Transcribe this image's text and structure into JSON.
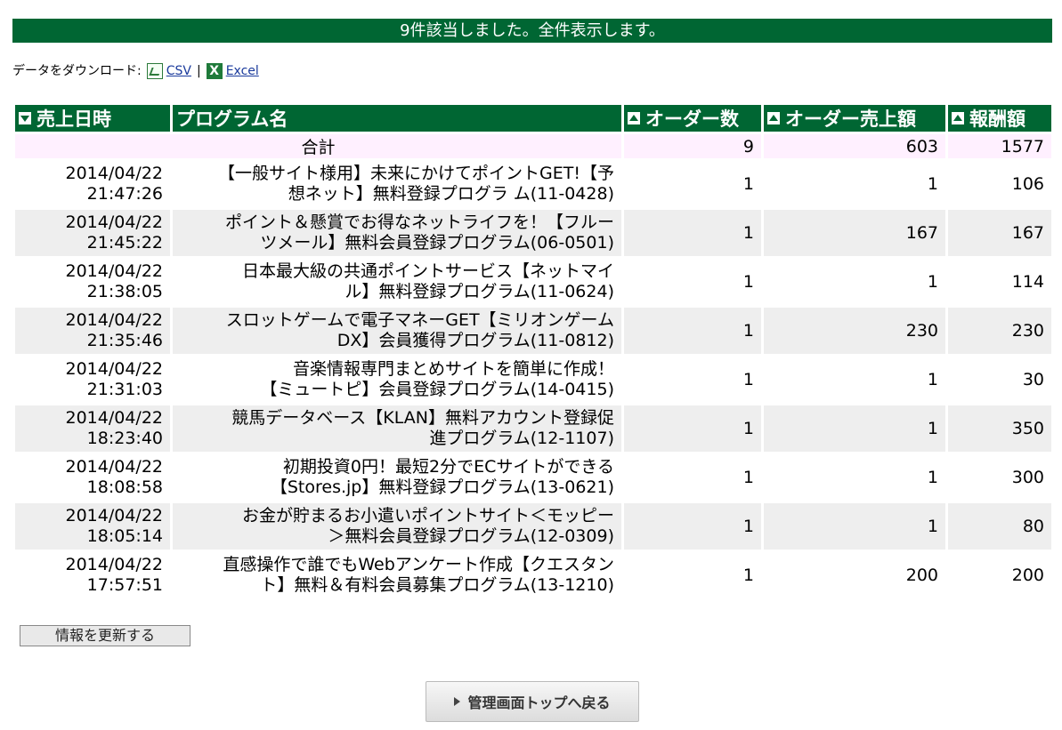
{
  "banner": {
    "text": "9件該当しました。全件表示します。"
  },
  "download": {
    "label": "データをダウンロード:",
    "csv_icon": "csv-file-icon",
    "csv_label": "CSV",
    "separator": "|",
    "excel_icon": "excel-file-icon",
    "excel_label": "Excel"
  },
  "table": {
    "headers": [
      {
        "label": "売上日時",
        "sort": "down"
      },
      {
        "label": "プログラム名",
        "sort": "none"
      },
      {
        "label": "オーダー数",
        "sort": "up"
      },
      {
        "label": "オーダー売上額",
        "sort": "up"
      },
      {
        "label": "報酬額",
        "sort": "up"
      }
    ],
    "total": {
      "label": "合計",
      "orders": "9",
      "sales": "603",
      "reward": "1577"
    },
    "rows": [
      {
        "date": "2014/04/22",
        "time": "21:47:26",
        "program_l1": "【一般サイト様用】未来にかけてポイントGET!【予",
        "program_l2": "想ネット】無料登録プログラ ム(11-0428)",
        "orders": "1",
        "sales": "1",
        "reward": "106"
      },
      {
        "date": "2014/04/22",
        "time": "21:45:22",
        "program_l1": "ポイント＆懸賞でお得なネットライフを！【フルー",
        "program_l2": "ツメール】無料会員登録プログラム(06-0501)",
        "orders": "1",
        "sales": "167",
        "reward": "167"
      },
      {
        "date": "2014/04/22",
        "time": "21:38:05",
        "program_l1": "日本最大級の共通ポイントサービス【ネットマイ",
        "program_l2": "ル】無料登録プログラム(11-0624)",
        "orders": "1",
        "sales": "1",
        "reward": "114"
      },
      {
        "date": "2014/04/22",
        "time": "21:35:46",
        "program_l1": "スロットゲームで電子マネーGET【ミリオンゲーム",
        "program_l2": "DX】会員獲得プログラム(11-0812)",
        "orders": "1",
        "sales": "230",
        "reward": "230"
      },
      {
        "date": "2014/04/22",
        "time": "21:31:03",
        "program_l1": "音楽情報専門まとめサイトを簡単に作成！",
        "program_l2": "【ミュートピ】会員登録プログラム(14-0415)",
        "orders": "1",
        "sales": "1",
        "reward": "30"
      },
      {
        "date": "2014/04/22",
        "time": "18:23:40",
        "program_l1": "競馬データベース【KLAN】無料アカウント登録促",
        "program_l2": "進プログラム(12-1107)",
        "orders": "1",
        "sales": "1",
        "reward": "350"
      },
      {
        "date": "2014/04/22",
        "time": "18:08:58",
        "program_l1": "初期投資0円！最短2分でECサイトができる",
        "program_l2": "【Stores.jp】無料登録プログラム(13-0621)",
        "orders": "1",
        "sales": "1",
        "reward": "300"
      },
      {
        "date": "2014/04/22",
        "time": "18:05:14",
        "program_l1": "お金が貯まるお小遣いポイントサイト＜モッピー",
        "program_l2": "＞無料会員登録プログラム(12-0309)",
        "orders": "1",
        "sales": "1",
        "reward": "80"
      },
      {
        "date": "2014/04/22",
        "time": "17:57:51",
        "program_l1": "直感操作で誰でもWebアンケート作成【クエスタン",
        "program_l2": "ト】無料＆有料会員募集プログラム(13-1210)",
        "orders": "1",
        "sales": "200",
        "reward": "200"
      }
    ]
  },
  "buttons": {
    "refresh_label": "情報を更新する",
    "back_label": "管理画面トップへ戻る"
  },
  "colors": {
    "header_bg": "#006633",
    "total_bg": "#fff0ff",
    "alt_row_bg": "#eeeeee"
  }
}
